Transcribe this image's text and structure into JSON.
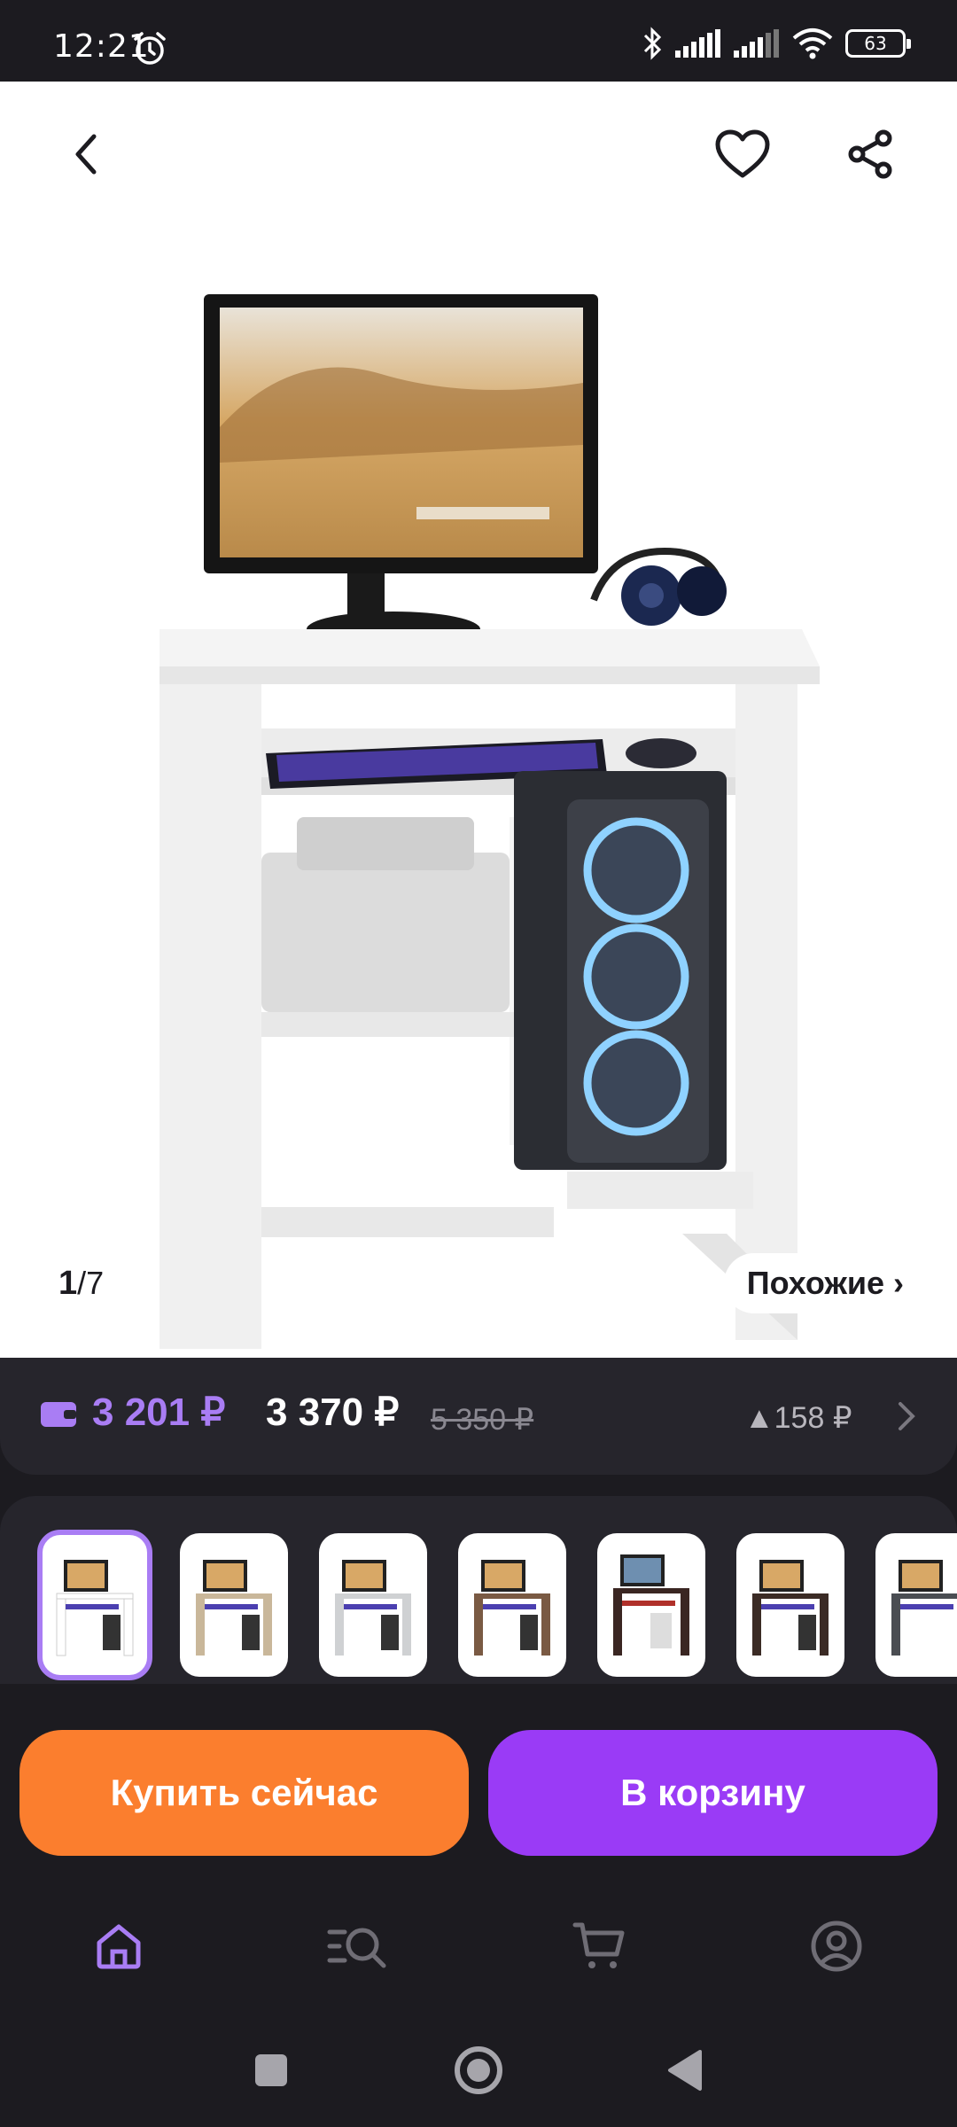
{
  "status_bar": {
    "time": "12:21",
    "battery": "63"
  },
  "gallery": {
    "current_index": "1",
    "separator": "/",
    "total": "7",
    "similar_label": "Похожие ›"
  },
  "price": {
    "card_price": "3 201 ₽",
    "price": "3 370 ₽",
    "old_price": "5 350 ₽",
    "delta": "▲158 ₽"
  },
  "variants": {
    "items": [
      {
        "name": "white",
        "color": "#ffffff"
      },
      {
        "name": "sonoma-oak",
        "color": "#c9b79a"
      },
      {
        "name": "grey",
        "color": "#cfd1d3"
      },
      {
        "name": "walnut",
        "color": "#7a5a43"
      },
      {
        "name": "wenge-red",
        "color": "#3a2622"
      },
      {
        "name": "wenge",
        "color": "#3b2b25"
      },
      {
        "name": "graphite",
        "color": "#4a4d52"
      }
    ]
  },
  "actions": {
    "buy_now": "Купить сейчас",
    "add_to_cart": "В корзину"
  },
  "bottom_nav": {
    "items": [
      {
        "icon": "home-icon",
        "active": true
      },
      {
        "icon": "catalog-search-icon",
        "active": false
      },
      {
        "icon": "cart-icon",
        "active": false
      },
      {
        "icon": "profile-icon",
        "active": false
      }
    ]
  },
  "colors": {
    "accent": "#a97df4",
    "buy_button": "#fb7e2e",
    "cart_button": "#9a3bf6",
    "background": "#1c1b20",
    "panel": "#26252c"
  }
}
